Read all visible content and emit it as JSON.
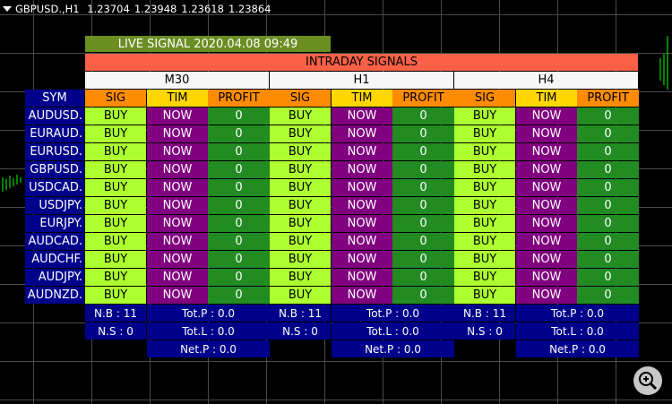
{
  "chart": {
    "symbol_label": "GBPUSD.,H1",
    "open": "1.23704",
    "high": "1.23948",
    "low": "1.23618",
    "close": "1.23864"
  },
  "panel": {
    "live_signal": "LIVE SIGNAL 2020.04.08 09:49",
    "intraday_title": "INTRADAY SIGNALS",
    "timeframes": [
      "M30",
      "H1",
      "H4"
    ],
    "sym_header": "SYM",
    "col_headers": {
      "sig": "SIG",
      "tim": "TIM",
      "profit": "PROFIT"
    },
    "rows": [
      {
        "sym": "AUDUSD.",
        "cells": [
          {
            "sig": "BUY",
            "tim": "NOW",
            "profit": "0"
          },
          {
            "sig": "BUY",
            "tim": "NOW",
            "profit": "0"
          },
          {
            "sig": "BUY",
            "tim": "NOW",
            "profit": "0"
          }
        ]
      },
      {
        "sym": "EURAUD.",
        "cells": [
          {
            "sig": "BUY",
            "tim": "NOW",
            "profit": "0"
          },
          {
            "sig": "BUY",
            "tim": "NOW",
            "profit": "0"
          },
          {
            "sig": "BUY",
            "tim": "NOW",
            "profit": "0"
          }
        ]
      },
      {
        "sym": "EURUSD.",
        "cells": [
          {
            "sig": "BUY",
            "tim": "NOW",
            "profit": "0"
          },
          {
            "sig": "BUY",
            "tim": "NOW",
            "profit": "0"
          },
          {
            "sig": "BUY",
            "tim": "NOW",
            "profit": "0"
          }
        ]
      },
      {
        "sym": "GBPUSD.",
        "cells": [
          {
            "sig": "BUY",
            "tim": "NOW",
            "profit": "0"
          },
          {
            "sig": "BUY",
            "tim": "NOW",
            "profit": "0"
          },
          {
            "sig": "BUY",
            "tim": "NOW",
            "profit": "0"
          }
        ]
      },
      {
        "sym": "USDCAD.",
        "cells": [
          {
            "sig": "BUY",
            "tim": "NOW",
            "profit": "0"
          },
          {
            "sig": "BUY",
            "tim": "NOW",
            "profit": "0"
          },
          {
            "sig": "BUY",
            "tim": "NOW",
            "profit": "0"
          }
        ]
      },
      {
        "sym": "USDJPY.",
        "cells": [
          {
            "sig": "BUY",
            "tim": "NOW",
            "profit": "0"
          },
          {
            "sig": "BUY",
            "tim": "NOW",
            "profit": "0"
          },
          {
            "sig": "BUY",
            "tim": "NOW",
            "profit": "0"
          }
        ]
      },
      {
        "sym": "EURJPY.",
        "cells": [
          {
            "sig": "BUY",
            "tim": "NOW",
            "profit": "0"
          },
          {
            "sig": "BUY",
            "tim": "NOW",
            "profit": "0"
          },
          {
            "sig": "BUY",
            "tim": "NOW",
            "profit": "0"
          }
        ]
      },
      {
        "sym": "AUDCAD.",
        "cells": [
          {
            "sig": "BUY",
            "tim": "NOW",
            "profit": "0"
          },
          {
            "sig": "BUY",
            "tim": "NOW",
            "profit": "0"
          },
          {
            "sig": "BUY",
            "tim": "NOW",
            "profit": "0"
          }
        ]
      },
      {
        "sym": "AUDCHF.",
        "cells": [
          {
            "sig": "BUY",
            "tim": "NOW",
            "profit": "0"
          },
          {
            "sig": "BUY",
            "tim": "NOW",
            "profit": "0"
          },
          {
            "sig": "BUY",
            "tim": "NOW",
            "profit": "0"
          }
        ]
      },
      {
        "sym": "AUDJPY.",
        "cells": [
          {
            "sig": "BUY",
            "tim": "NOW",
            "profit": "0"
          },
          {
            "sig": "BUY",
            "tim": "NOW",
            "profit": "0"
          },
          {
            "sig": "BUY",
            "tim": "NOW",
            "profit": "0"
          }
        ]
      },
      {
        "sym": "AUDNZD.",
        "cells": [
          {
            "sig": "BUY",
            "tim": "NOW",
            "profit": "0"
          },
          {
            "sig": "BUY",
            "tim": "NOW",
            "profit": "0"
          },
          {
            "sig": "BUY",
            "tim": "NOW",
            "profit": "0"
          }
        ]
      }
    ],
    "summaries": [
      {
        "nb": "N.B : 11",
        "ns": "N.S : 0",
        "totp": "Tot.P : 0.0",
        "totl": "Tot.L : 0.0",
        "netp": "Net.P : 0.0"
      },
      {
        "nb": "N.B : 11",
        "ns": "N.S : 0",
        "totp": "Tot.P : 0.0",
        "totl": "Tot.L : 0.0",
        "netp": "Net.P : 0.0"
      },
      {
        "nb": "N.B : 11",
        "ns": "N.S : 0",
        "totp": "Tot.P : 0.0",
        "totl": "Tot.L : 0.0",
        "netp": "Net.P : 0.0"
      }
    ]
  },
  "colors": {
    "background": "#000000",
    "grid": "#4a4a4a",
    "candle_up": "#00ff00",
    "live_bar": "#6b8e23",
    "intraday_bar": "#fa6147",
    "sym_column": "#00008b",
    "sig_header": "#ff8c00",
    "tim_header": "#ffd700",
    "sig_cell": "#adff2f",
    "tim_cell": "#800080",
    "profit_cell": "#228b22"
  },
  "icons": {
    "menu": "triangle-down-icon",
    "zoom": "zoom-in-icon"
  }
}
